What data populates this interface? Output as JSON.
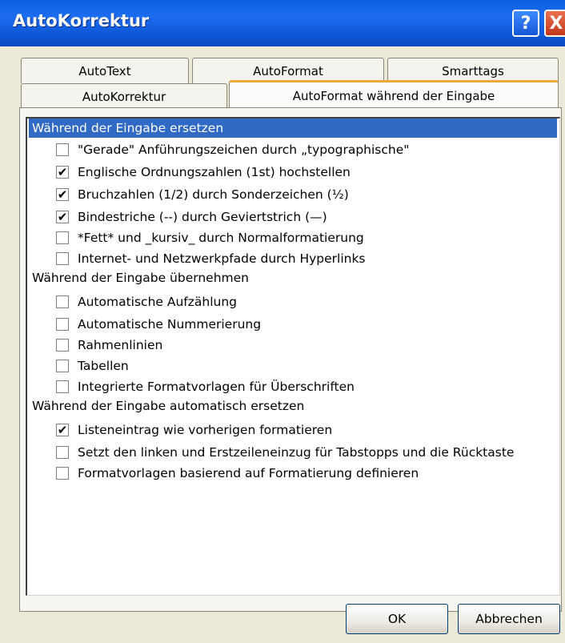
{
  "window": {
    "title": "AutoKorrektur"
  },
  "titlebar_buttons": {
    "help": "?",
    "close": "X"
  },
  "tabs": [
    {
      "label": "AutoText"
    },
    {
      "label": "AutoFormat"
    },
    {
      "label": "Smarttags"
    },
    {
      "label": "AutoKorrektur"
    },
    {
      "label": "AutoFormat während der Eingabe",
      "active": true
    }
  ],
  "groups": [
    {
      "title": "Während der Eingabe ersetzen",
      "items": [
        {
          "label": "\"Gerade\" Anführungszeichen durch „typographische\"",
          "checked": false
        },
        {
          "label": "Englische Ordnungszahlen (1st) hochstellen",
          "checked": true
        },
        {
          "label": "Bruchzahlen (1/2) durch Sonderzeichen (½)",
          "checked": true
        },
        {
          "label": "Bindestriche (--) durch Geviertstrich (—)",
          "checked": true
        },
        {
          "label": "*Fett* und _kursiv_ durch Normalformatierung",
          "checked": false
        },
        {
          "label": "Internet- und Netzwerkpfade durch Hyperlinks",
          "checked": false
        }
      ]
    },
    {
      "title": "Während der Eingabe übernehmen",
      "items": [
        {
          "label": "Automatische Aufzählung",
          "checked": false
        },
        {
          "label": "Automatische Nummerierung",
          "checked": false
        },
        {
          "label": "Rahmenlinien",
          "checked": false
        },
        {
          "label": "Tabellen",
          "checked": false
        },
        {
          "label": "Integrierte Formatvorlagen für Überschriften",
          "checked": false
        }
      ]
    },
    {
      "title": "Während der Eingabe automatisch ersetzen",
      "items": [
        {
          "label": "Listeneintrag wie vorherigen formatieren",
          "checked": true
        },
        {
          "label": "Setzt den linken und Erstzeileneinzug für Tabstopps und die Rücktaste",
          "checked": false
        },
        {
          "label": "Formatvorlagen basierend auf Formatierung definieren",
          "checked": false
        }
      ]
    }
  ],
  "buttons": {
    "ok": "OK",
    "cancel": "Abbrechen"
  },
  "check_mark": "✔"
}
